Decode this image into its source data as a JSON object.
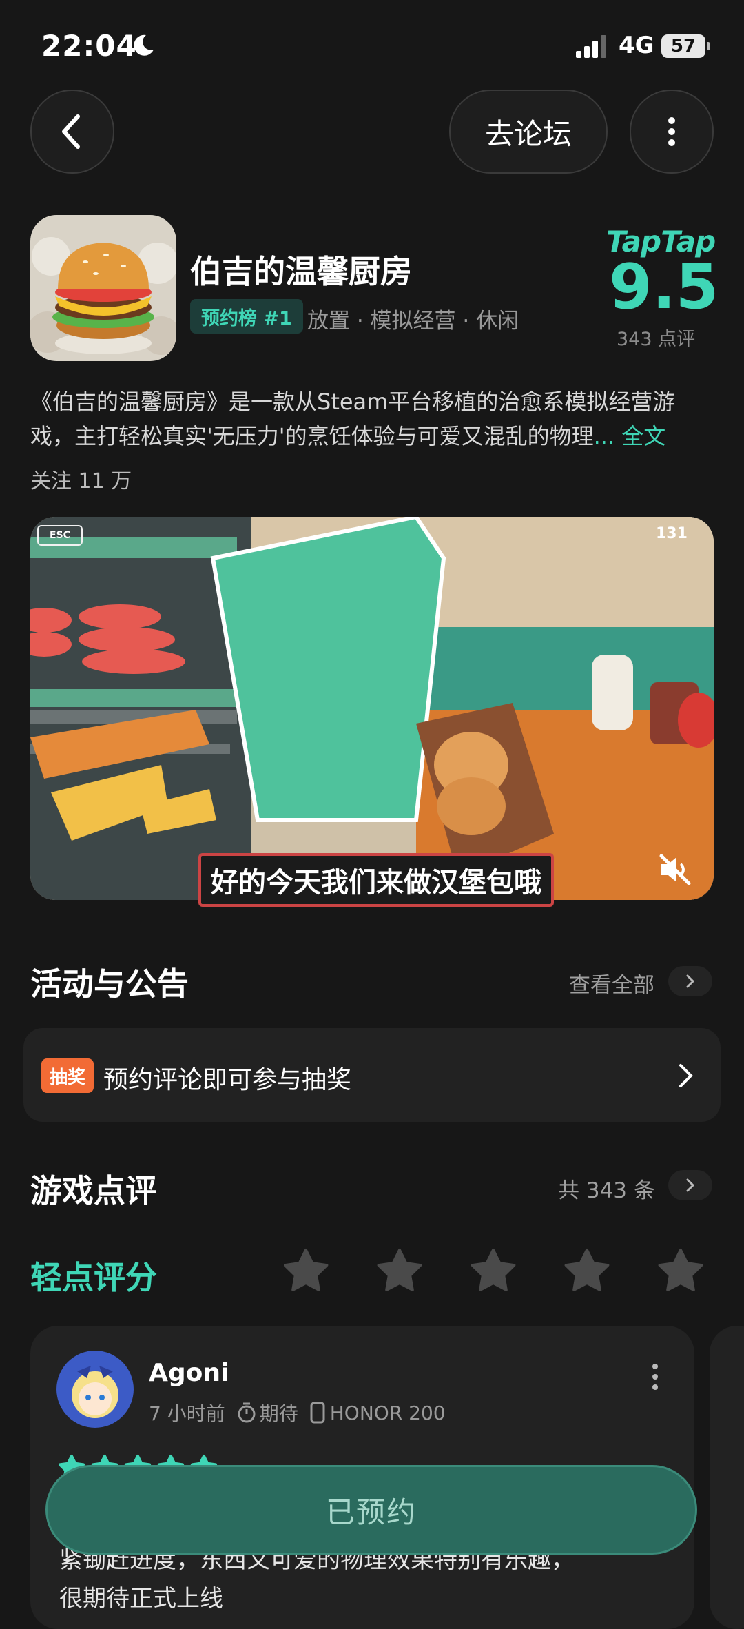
{
  "status_bar": {
    "time": "22:04",
    "network": "4G",
    "battery": "57"
  },
  "nav": {
    "forum_label": "去论坛"
  },
  "game": {
    "title": "伯吉的温馨厨房",
    "rank_badge": "预约榜 #1",
    "tags": "放置 · 模拟经营 · 休闲",
    "platform_logo": "TapTap",
    "score": "9.5",
    "rating_count": "343 点评",
    "description": "《伯吉的温馨厨房》是一款从Steam平台移植的治愈系模拟经营游戏，主打轻松真实'无压力'的烹饪体验与可爱又混乱的物理",
    "description_more": "... 全文",
    "follow": "关注 11 万"
  },
  "video": {
    "esc_label": "ESC",
    "coin_count": "131",
    "subtitle": "好的今天我们来做汉堡包哦"
  },
  "activities": {
    "title": "活动与公告",
    "see_all": "查看全部",
    "item": {
      "badge": "抽奖",
      "text": "预约评论即可参与抽奖"
    }
  },
  "reviews": {
    "title": "游戏点评",
    "total": "共 343 条",
    "tap_rate_label": "轻点评分",
    "rating_stars": 5,
    "card": {
      "user": "Agoni",
      "time": "7 小时前",
      "status": "期待",
      "device": "HONOR 200",
      "stars": 5,
      "line1": "紧锄赶进度，东西又可爱的物理效果特别有乐趣，",
      "line2": "很期待正式上线"
    }
  },
  "reserve_button": "已预约",
  "colors": {
    "accent": "#3fd6b6",
    "lottery": "#f26b35",
    "background": "#171717"
  }
}
